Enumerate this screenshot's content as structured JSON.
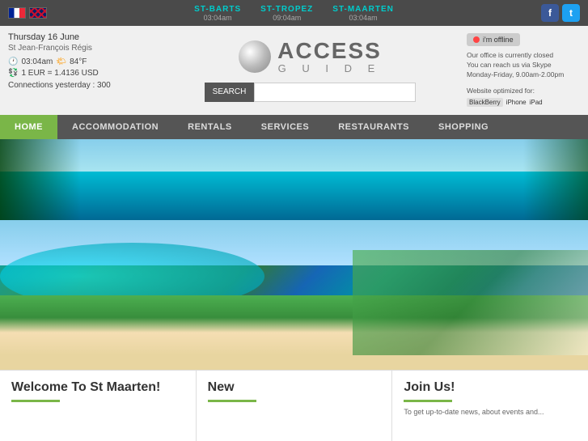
{
  "topbar": {
    "destinations": [
      {
        "name": "ST-BARTS",
        "time": "03:04am"
      },
      {
        "name": "ST-TROPEZ",
        "time": "09:04am"
      },
      {
        "name": "ST-MAARTEN",
        "time": "03:04am"
      }
    ],
    "social": {
      "facebook_label": "f",
      "twitter_label": "t"
    }
  },
  "header": {
    "date": "Thursday 16 June",
    "owner": "St Jean-François Régis",
    "time": "03:04am",
    "weather": "84°F",
    "currency": "1 EUR = 1.4136 USD",
    "connections": "Connections yesterday : 300",
    "logo_access": "ACCESS",
    "logo_guide": "G U I D E",
    "search_label": "SEARCH",
    "search_placeholder": "",
    "offline_label": "i'm offline",
    "offline_text": "Our office is currently closed\nYou can reach us via Skype\nMonday-Friday, 9.00am-2.00pm",
    "optimized_label": "Website optimized for:",
    "device_bb": "BlackBerry",
    "device_iphone": "iPhone",
    "device_ipad": "iPad"
  },
  "nav": {
    "items": [
      {
        "label": "HOME",
        "active": true
      },
      {
        "label": "ACCOMMODATION",
        "active": false
      },
      {
        "label": "RENTALS",
        "active": false
      },
      {
        "label": "SERVICES",
        "active": false
      },
      {
        "label": "RESTAURANTS",
        "active": false
      },
      {
        "label": "SHOPPING",
        "active": false
      }
    ]
  },
  "bottom": {
    "welcome_title": "Welcome To St Maarten!",
    "new_title": "New",
    "join_title": "Join Us!",
    "join_text": "To get up-to-date news, about events and..."
  }
}
